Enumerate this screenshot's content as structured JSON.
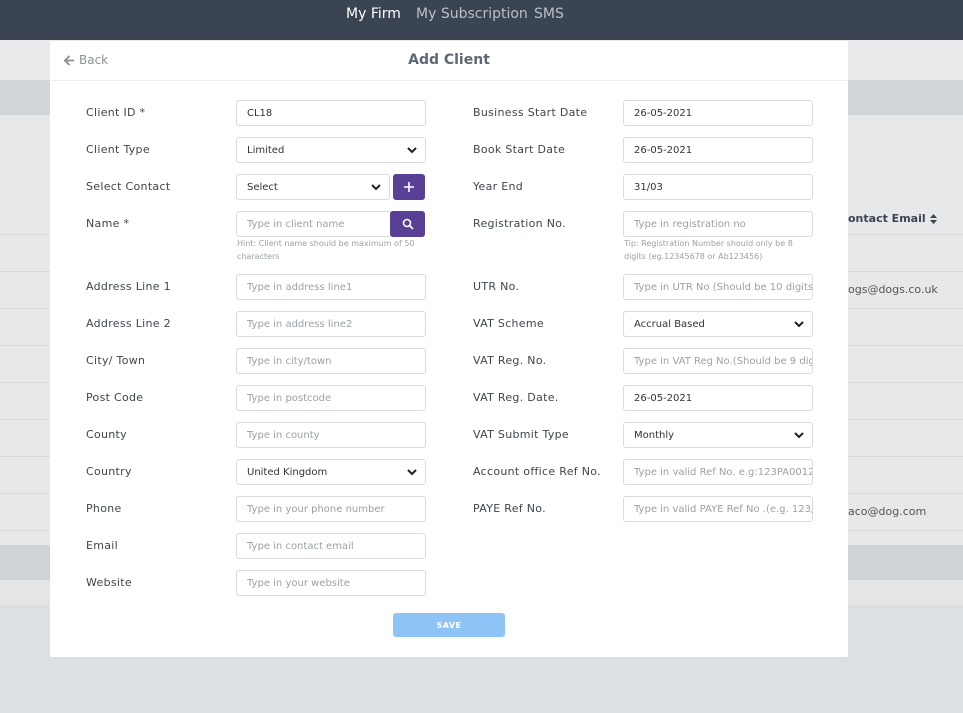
{
  "nav": {
    "items": [
      "My Firm",
      "My Subscription",
      "SMS"
    ]
  },
  "background": {
    "column_header": "ontact Email",
    "cells": [
      "ogs@dogs.co.uk",
      "aco@dog.com"
    ]
  },
  "modal": {
    "back_label": "Back",
    "title": "Add Client",
    "left": {
      "client_id": {
        "label": "Client ID *",
        "value": "CL18"
      },
      "client_type": {
        "label": "Client Type",
        "value": "Limited"
      },
      "select_contact": {
        "label": "Select Contact",
        "value": "Select"
      },
      "name": {
        "label": "Name *",
        "placeholder": "Type in client name",
        "hint": "Hint: Client name should be maximum of 50 characters"
      },
      "address1": {
        "label": "Address Line 1",
        "placeholder": "Type in address line1"
      },
      "address2": {
        "label": "Address Line 2",
        "placeholder": "Type in address line2"
      },
      "city": {
        "label": "City/ Town",
        "placeholder": "Type in city/town"
      },
      "postcode": {
        "label": "Post Code",
        "placeholder": "Type in postcode"
      },
      "county": {
        "label": "County",
        "placeholder": "Type in county"
      },
      "country": {
        "label": "Country",
        "value": "United Kingdom"
      },
      "phone": {
        "label": "Phone",
        "placeholder": "Type in your phone number"
      },
      "email": {
        "label": "Email",
        "placeholder": "Type in contact email"
      },
      "website": {
        "label": "Website",
        "placeholder": "Type in your website"
      }
    },
    "right": {
      "business_start": {
        "label": "Business Start Date",
        "value": "26-05-2021"
      },
      "book_start": {
        "label": "Book Start Date",
        "value": "26-05-2021"
      },
      "year_end": {
        "label": "Year End",
        "value": "31/03"
      },
      "registration": {
        "label": "Registration No.",
        "placeholder": "Type in registration no",
        "hint": "Tip: Registration Number should only be 8 digits (eg.12345678 or Ab123456)"
      },
      "utr": {
        "label": "UTR No.",
        "placeholder": "Type in UTR No (Should be 10 digits)"
      },
      "vat_scheme": {
        "label": "VAT Scheme",
        "value": "Accrual Based"
      },
      "vat_reg_no": {
        "label": "VAT Reg. No.",
        "placeholder": "Type in VAT Reg No.(Should be 9 dig..."
      },
      "vat_reg_date": {
        "label": "VAT Reg. Date.",
        "value": "26-05-2021"
      },
      "vat_submit": {
        "label": "VAT Submit Type",
        "value": "Monthly"
      },
      "account_office": {
        "label": "Account office Ref No.",
        "placeholder": "Type in valid Ref No. e.g:123PA00123..."
      },
      "paye": {
        "label": "PAYE Ref No.",
        "placeholder": "Type in valid PAYE Ref No .(e.g. 123/A..."
      }
    },
    "save_label": "SAVE"
  },
  "colors": {
    "nav_bg": "#3b4452",
    "accent_purple": "#5a3f96",
    "save_button": "#8ec4f5"
  }
}
